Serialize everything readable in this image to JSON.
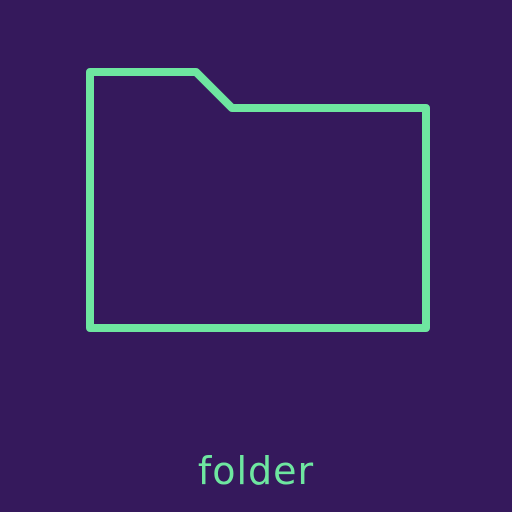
{
  "icon": {
    "name": "folder-icon",
    "label": "folder"
  },
  "colors": {
    "background": "#35195c",
    "stroke": "#6ee6a0"
  }
}
